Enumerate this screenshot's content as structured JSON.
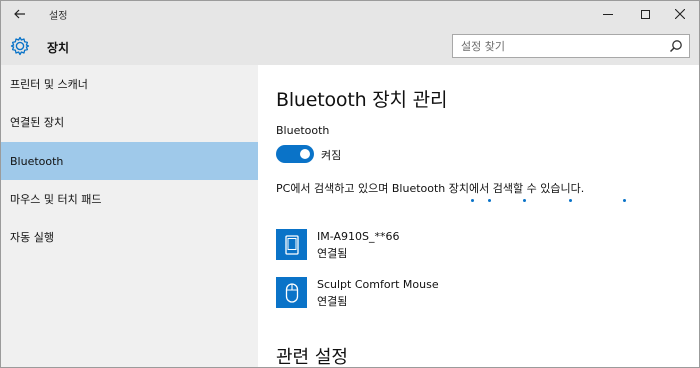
{
  "window": {
    "title": "설정"
  },
  "header": {
    "title": "장치",
    "search_placeholder": "설정 찾기"
  },
  "sidebar": {
    "items": [
      {
        "label": "프린터 및 스캐너",
        "selected": false
      },
      {
        "label": "연결된 장치",
        "selected": false
      },
      {
        "label": "Bluetooth",
        "selected": true
      },
      {
        "label": "마우스 및 터치 패드",
        "selected": false
      },
      {
        "label": "자동 실행",
        "selected": false
      }
    ]
  },
  "main": {
    "title": "Bluetooth 장치 관리",
    "bluetooth_label": "Bluetooth",
    "toggle_state": "켜짐",
    "toggle_on": true,
    "status_text": "PC에서 검색하고 있으며 Bluetooth 장치에서 검색할 수 있습니다.",
    "devices": [
      {
        "name": "IM-A910S_**66",
        "status": "연결됨",
        "icon": "phone-icon"
      },
      {
        "name": "Sculpt Comfort Mouse",
        "status": "연결됨",
        "icon": "mouse-icon"
      }
    ],
    "related_title": "관련 설정"
  },
  "colors": {
    "accent": "#0a73c8",
    "selected": "#9fc9ea",
    "sidebar_bg": "#f0f0f0",
    "titlebar_bg": "#e6e6e6"
  }
}
